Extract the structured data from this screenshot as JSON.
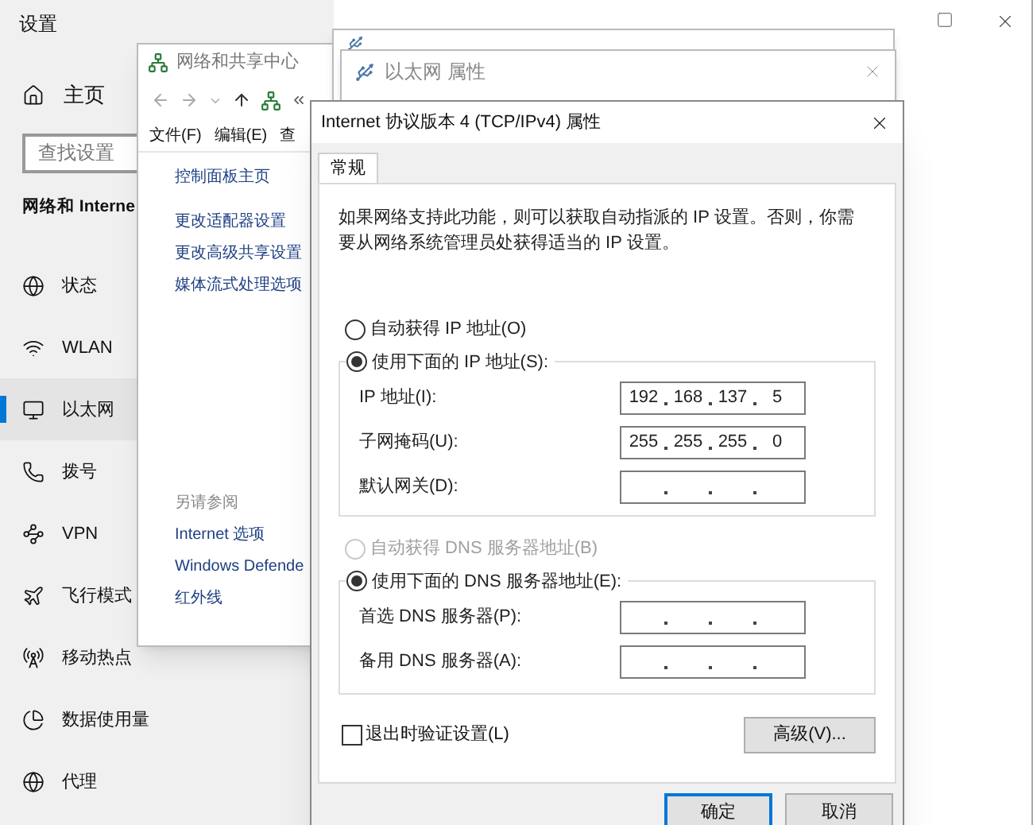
{
  "settings": {
    "title": "设置",
    "home": "主页",
    "search": {
      "placeholder": "查找设置"
    },
    "section": "网络和 Interne",
    "items": [
      {
        "label": "状态",
        "selected": false
      },
      {
        "label": "WLAN",
        "selected": false
      },
      {
        "label": "以太网",
        "selected": true
      },
      {
        "label": "拨号",
        "selected": false
      },
      {
        "label": "VPN",
        "selected": false
      },
      {
        "label": "飞行模式",
        "selected": false
      },
      {
        "label": "移动热点",
        "selected": false
      },
      {
        "label": "数据使用量",
        "selected": false
      },
      {
        "label": "代理",
        "selected": false
      }
    ]
  },
  "network_center": {
    "title": "网络和共享中心",
    "menu": [
      "文件(F)",
      "编辑(E)",
      "查"
    ],
    "links": [
      "控制面板主页",
      "更改适配器设置",
      "更改高级共享设置",
      "媒体流式处理选项"
    ],
    "see_also": {
      "heading": "另请参阅",
      "links": [
        "Internet 选项",
        "Windows Defende",
        "红外线"
      ]
    }
  },
  "ethernet_properties": {
    "title": "以太网 属性"
  },
  "tcpip_dialog": {
    "title": "Internet 协议版本 4 (TCP/IPv4) 属性",
    "tabs": [
      {
        "label": "常规",
        "selected": true
      }
    ],
    "description": "如果网络支持此功能，则可以获取自动指派的 IP 设置。否则，你需要从网络系统管理员处获得适当的 IP 设置。",
    "ip_mode": [
      {
        "label": "自动获得 IP 地址(O)",
        "selected": false,
        "disabled": false
      },
      {
        "label": "使用下面的 IP 地址(S):",
        "selected": true,
        "disabled": false
      }
    ],
    "ip_fields": [
      {
        "label": "IP 地址(I):",
        "octets": [
          "192",
          "168",
          "137",
          "5"
        ]
      },
      {
        "label": "子网掩码(U):",
        "octets": [
          "255",
          "255",
          "255",
          "0"
        ]
      },
      {
        "label": "默认网关(D):"
      }
    ],
    "dns_mode": [
      {
        "label": "自动获得 DNS 服务器地址(B)",
        "selected": false,
        "disabled": true
      },
      {
        "label": "使用下面的 DNS 服务器地址(E):",
        "selected": true,
        "disabled": false
      }
    ],
    "dns_fields": [
      {
        "label": "首选 DNS 服务器(P):"
      },
      {
        "label": "备用 DNS 服务器(A):"
      }
    ],
    "validate_checkbox": {
      "label": "退出时验证设置(L)",
      "checked": false
    },
    "advanced_button": "高级(V)...",
    "buttons": [
      {
        "label": "确定",
        "default": true
      },
      {
        "label": "取消",
        "default": false
      }
    ]
  }
}
